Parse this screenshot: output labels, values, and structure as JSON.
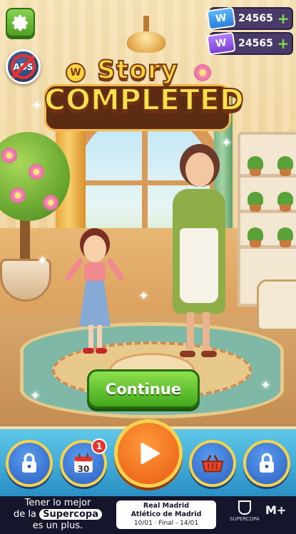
{
  "hud": {
    "no_ads_label": "ADS",
    "currencies": [
      {
        "ticket_letter": "W",
        "amount": "24565",
        "plus": "+",
        "color": "#2a7fd8"
      },
      {
        "ticket_letter": "W",
        "amount": "24565",
        "plus": "+",
        "color": "#7b3fd6"
      }
    ]
  },
  "title": {
    "badge_letter": "W",
    "line1": "Story",
    "line2": "COMPLETED"
  },
  "continue_label": "Continue",
  "bottom_nav": {
    "calendar_day": "30",
    "calendar_badge": "1",
    "items": [
      {
        "name": "locked-left",
        "icon": "lock-icon"
      },
      {
        "name": "calendar",
        "icon": "calendar-icon"
      },
      {
        "name": "play",
        "icon": "play-icon"
      },
      {
        "name": "shop",
        "icon": "basket-icon"
      },
      {
        "name": "locked-right",
        "icon": "lock-icon"
      }
    ]
  },
  "ad": {
    "line1": "Tener lo mejor",
    "line2_prefix": "de la",
    "line2_pill": "Supercopa",
    "line3": "es un plus.",
    "match_team1": "Real Madrid",
    "match_team2": "Atlético de Madrid",
    "dates": "10/01 · Final - 14/01",
    "logo_text": "SUPERCOPA",
    "brand": "M+"
  },
  "colors": {
    "green_button": "#43a81d",
    "nav_blue": "#2a5fc0",
    "play_orange": "#e85a10",
    "title_yellow": "#ffd23f"
  }
}
